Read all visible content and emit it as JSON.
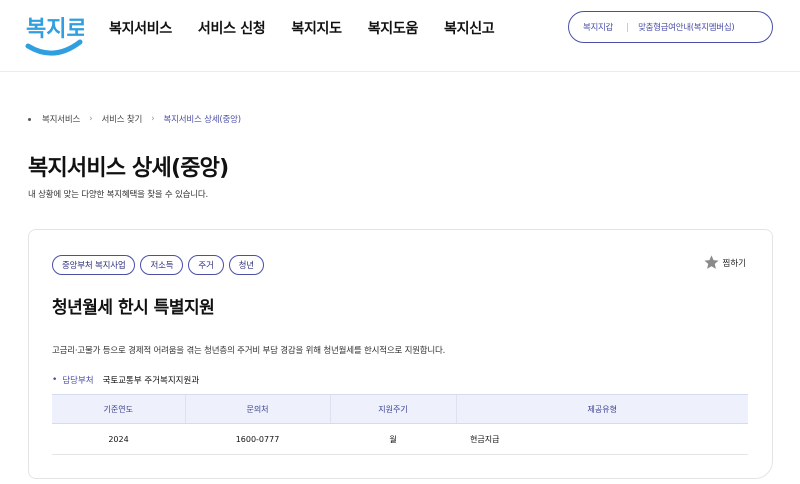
{
  "header": {
    "logo_text": "복지로",
    "nav": [
      "복지서비스",
      "서비스 신청",
      "복지지도",
      "복지도움",
      "복지신고"
    ],
    "util_links": [
      "복지지갑",
      "맞춤형급여안내(복지멤버십)"
    ]
  },
  "breadcrumb": [
    "복지서비스",
    "서비스 찾기",
    "복지서비스 상세(중앙)"
  ],
  "page": {
    "title": "복지서비스 상세(중앙)",
    "description": "내 상황에 맞는 다양한 복지혜택을 찾을 수 있습니다."
  },
  "service": {
    "tags": [
      "중앙부처 복지사업",
      "저소득",
      "주거",
      "청년"
    ],
    "bookmark_label": "찜하기",
    "title": "청년월세 한시 특별지원",
    "description": "고금리·고물가 등으로 경제적 어려움을 겪는 청년층의 주거비 부담 경감을 위해 청년월세를 한시적으로 지원합니다.",
    "dept_label": "담당부처",
    "dept_value": "국토교통부 주거복지지원과",
    "table": {
      "headers": [
        "기준연도",
        "문의처",
        "지원주기",
        "제공유형"
      ],
      "row": [
        "2024",
        "1600-0777",
        "월",
        "현금지급"
      ]
    }
  },
  "colors": {
    "accent": "#4b4fa8",
    "logo_blue": "#2f9fe0",
    "table_header_bg": "#eef1fb"
  }
}
